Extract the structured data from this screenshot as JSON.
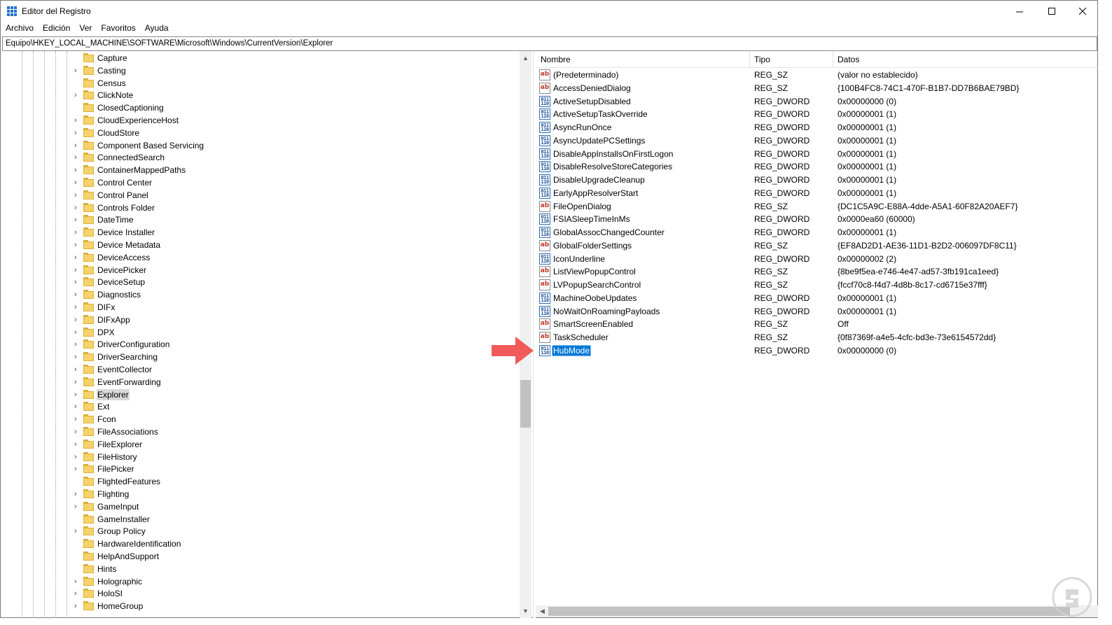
{
  "window": {
    "title": "Editor del Registro",
    "buttons": {
      "minimize": "—",
      "maximize": "☐",
      "close": "✕"
    }
  },
  "menu": [
    "Archivo",
    "Edición",
    "Ver",
    "Favoritos",
    "Ayuda"
  ],
  "address": "Equipo\\HKEY_LOCAL_MACHINE\\SOFTWARE\\Microsoft\\Windows\\CurrentVersion\\Explorer",
  "tree": [
    {
      "label": "Capture",
      "expandable": false
    },
    {
      "label": "Casting",
      "expandable": true
    },
    {
      "label": "Census",
      "expandable": false
    },
    {
      "label": "ClickNote",
      "expandable": true
    },
    {
      "label": "ClosedCaptioning",
      "expandable": false
    },
    {
      "label": "CloudExperienceHost",
      "expandable": true
    },
    {
      "label": "CloudStore",
      "expandable": true
    },
    {
      "label": "Component Based Servicing",
      "expandable": true
    },
    {
      "label": "ConnectedSearch",
      "expandable": true
    },
    {
      "label": "ContainerMappedPaths",
      "expandable": true
    },
    {
      "label": "Control Center",
      "expandable": true
    },
    {
      "label": "Control Panel",
      "expandable": true
    },
    {
      "label": "Controls Folder",
      "expandable": true
    },
    {
      "label": "DateTime",
      "expandable": true
    },
    {
      "label": "Device Installer",
      "expandable": true
    },
    {
      "label": "Device Metadata",
      "expandable": true
    },
    {
      "label": "DeviceAccess",
      "expandable": true
    },
    {
      "label": "DevicePicker",
      "expandable": true
    },
    {
      "label": "DeviceSetup",
      "expandable": true
    },
    {
      "label": "Diagnostics",
      "expandable": true
    },
    {
      "label": "DIFx",
      "expandable": true
    },
    {
      "label": "DIFxApp",
      "expandable": true
    },
    {
      "label": "DPX",
      "expandable": true
    },
    {
      "label": "DriverConfiguration",
      "expandable": true
    },
    {
      "label": "DriverSearching",
      "expandable": true
    },
    {
      "label": "EventCollector",
      "expandable": true
    },
    {
      "label": "EventForwarding",
      "expandable": true
    },
    {
      "label": "Explorer",
      "expandable": true,
      "selected": true
    },
    {
      "label": "Ext",
      "expandable": true
    },
    {
      "label": "Fcon",
      "expandable": true
    },
    {
      "label": "FileAssociations",
      "expandable": true
    },
    {
      "label": "FileExplorer",
      "expandable": true
    },
    {
      "label": "FileHistory",
      "expandable": true
    },
    {
      "label": "FilePicker",
      "expandable": true
    },
    {
      "label": "FlightedFeatures",
      "expandable": false
    },
    {
      "label": "Flighting",
      "expandable": true
    },
    {
      "label": "GameInput",
      "expandable": true
    },
    {
      "label": "GameInstaller",
      "expandable": false
    },
    {
      "label": "Group Policy",
      "expandable": true
    },
    {
      "label": "HardwareIdentification",
      "expandable": false
    },
    {
      "label": "HelpAndSupport",
      "expandable": false
    },
    {
      "label": "Hints",
      "expandable": false
    },
    {
      "label": "Holographic",
      "expandable": true
    },
    {
      "label": "HoloSI",
      "expandable": true
    },
    {
      "label": "HomeGroup",
      "expandable": true
    }
  ],
  "list": {
    "headers": {
      "name": "Nombre",
      "type": "Tipo",
      "data": "Datos"
    },
    "rows": [
      {
        "kind": "sz",
        "name": "(Predeterminado)",
        "type": "REG_SZ",
        "data": "(valor no establecido)"
      },
      {
        "kind": "sz",
        "name": "AccessDeniedDialog",
        "type": "REG_SZ",
        "data": "{100B4FC8-74C1-470F-B1B7-DD7B6BAE79BD}"
      },
      {
        "kind": "dw",
        "name": "ActiveSetupDisabled",
        "type": "REG_DWORD",
        "data": "0x00000000 (0)"
      },
      {
        "kind": "dw",
        "name": "ActiveSetupTaskOverride",
        "type": "REG_DWORD",
        "data": "0x00000001 (1)"
      },
      {
        "kind": "dw",
        "name": "AsyncRunOnce",
        "type": "REG_DWORD",
        "data": "0x00000001 (1)"
      },
      {
        "kind": "dw",
        "name": "AsyncUpdatePCSettings",
        "type": "REG_DWORD",
        "data": "0x00000001 (1)"
      },
      {
        "kind": "dw",
        "name": "DisableAppInstallsOnFirstLogon",
        "type": "REG_DWORD",
        "data": "0x00000001 (1)"
      },
      {
        "kind": "dw",
        "name": "DisableResolveStoreCategories",
        "type": "REG_DWORD",
        "data": "0x00000001 (1)"
      },
      {
        "kind": "dw",
        "name": "DisableUpgradeCleanup",
        "type": "REG_DWORD",
        "data": "0x00000001 (1)"
      },
      {
        "kind": "dw",
        "name": "EarlyAppResolverStart",
        "type": "REG_DWORD",
        "data": "0x00000001 (1)"
      },
      {
        "kind": "sz",
        "name": "FileOpenDialog",
        "type": "REG_SZ",
        "data": "{DC1C5A9C-E88A-4dde-A5A1-60F82A20AEF7}"
      },
      {
        "kind": "dw",
        "name": "FSIASleepTimeInMs",
        "type": "REG_DWORD",
        "data": "0x0000ea60 (60000)"
      },
      {
        "kind": "dw",
        "name": "GlobalAssocChangedCounter",
        "type": "REG_DWORD",
        "data": "0x00000001 (1)"
      },
      {
        "kind": "sz",
        "name": "GlobalFolderSettings",
        "type": "REG_SZ",
        "data": "{EF8AD2D1-AE36-11D1-B2D2-006097DF8C11}"
      },
      {
        "kind": "dw",
        "name": "IconUnderline",
        "type": "REG_DWORD",
        "data": "0x00000002 (2)"
      },
      {
        "kind": "sz",
        "name": "ListViewPopupControl",
        "type": "REG_SZ",
        "data": "{8be9f5ea-e746-4e47-ad57-3fb191ca1eed}"
      },
      {
        "kind": "sz",
        "name": "LVPopupSearchControl",
        "type": "REG_SZ",
        "data": "{fccf70c8-f4d7-4d8b-8c17-cd6715e37fff}"
      },
      {
        "kind": "dw",
        "name": "MachineOobeUpdates",
        "type": "REG_DWORD",
        "data": "0x00000001 (1)"
      },
      {
        "kind": "dw",
        "name": "NoWaitOnRoamingPayloads",
        "type": "REG_DWORD",
        "data": "0x00000001 (1)"
      },
      {
        "kind": "sz",
        "name": "SmartScreenEnabled",
        "type": "REG_SZ",
        "data": "Off"
      },
      {
        "kind": "sz",
        "name": "TaskScheduler",
        "type": "REG_SZ",
        "data": "{0f87369f-a4e5-4cfc-bd3e-73e6154572dd}"
      },
      {
        "kind": "dw",
        "name": "HubMode",
        "type": "REG_DWORD",
        "data": "0x00000000 (0)",
        "selected": true
      }
    ]
  },
  "icons": {
    "sz": "ab",
    "dw": "011\n110"
  },
  "colors": {
    "selection": "#0078d7",
    "annotation_arrow": "#f05a5a",
    "tree_selection": "#d9d9d9"
  }
}
